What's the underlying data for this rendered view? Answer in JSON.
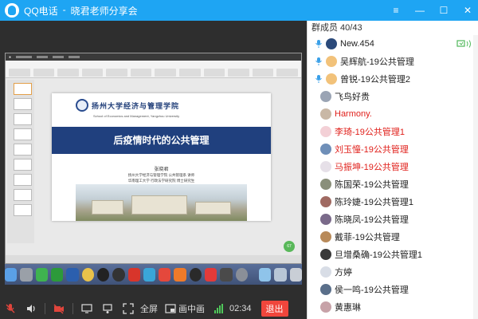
{
  "window": {
    "app_title": "QQ电话",
    "separator": "-",
    "session_title": "晓君老师分享会"
  },
  "colors": {
    "titlebar": "#1ea5f3",
    "toolbar": "#2e2e2e",
    "exit_button": "#f0463c",
    "red_name": "#e0201b",
    "slide_band": "#20407e"
  },
  "shared_screen": {
    "slide": {
      "title": "后疫情时代的公共管理",
      "university_cn": "扬州大学经济与管理学院",
      "university_en": "School of Economics and Management, Yangzhou University",
      "author": "张晓君",
      "affiliation_1": "扬州大学经济与管理学院 公共管理系 讲师",
      "affiliation_2": "华南理工大学 行政法学研究院 博士研究生"
    },
    "zoom_badge": "67"
  },
  "toolbar": {
    "fullscreen_label": "全屏",
    "pip_label": "画中画",
    "timer": "02:34",
    "exit_label": "退出"
  },
  "members": {
    "header": "群成员 40/43",
    "list": [
      {
        "name": "New.454",
        "red": false,
        "avatar": "#2b4a7a",
        "mic": true
      },
      {
        "name": "吴辉航-19公共管理",
        "red": false,
        "avatar": "#f2c27a",
        "mic": true
      },
      {
        "name": "曾锐-19公共管理2",
        "red": false,
        "avatar": "#f2c27a",
        "mic": true
      },
      {
        "name": "飞鸟好贵",
        "red": false,
        "avatar": "#9aa4b4",
        "mic": false
      },
      {
        "name": "Harmony.",
        "red": true,
        "avatar": "#c9b8a6",
        "mic": false
      },
      {
        "name": "李琦-19公共管理1",
        "red": true,
        "avatar": "#f3d0d6",
        "mic": false
      },
      {
        "name": "刘玉憧-19公共管理",
        "red": true,
        "avatar": "#6f8fb8",
        "mic": false
      },
      {
        "name": "马振坤-19公共管理",
        "red": true,
        "avatar": "#e6e0e8",
        "mic": false
      },
      {
        "name": "陈国荣-19公共管理",
        "red": false,
        "avatar": "#8a8f7a",
        "mic": false
      },
      {
        "name": "陈玲婕-19公共管理1",
        "red": false,
        "avatar": "#a06a62",
        "mic": false
      },
      {
        "name": "陈晓凤-19公共管理",
        "red": false,
        "avatar": "#7a6a8a",
        "mic": false
      },
      {
        "name": "戴菲-19公共管理",
        "red": false,
        "avatar": "#b88a5a",
        "mic": false
      },
      {
        "name": "旦增桑确-19公共管理1",
        "red": false,
        "avatar": "#3a3a3a",
        "mic": false
      },
      {
        "name": "方婷",
        "red": false,
        "avatar": "#d8dde6",
        "mic": false
      },
      {
        "name": "侯一鸣-19公共管理",
        "red": false,
        "avatar": "#5a6f8a",
        "mic": false
      },
      {
        "name": "黄惠琳",
        "red": false,
        "avatar": "#c7a2a8",
        "mic": false
      }
    ]
  }
}
